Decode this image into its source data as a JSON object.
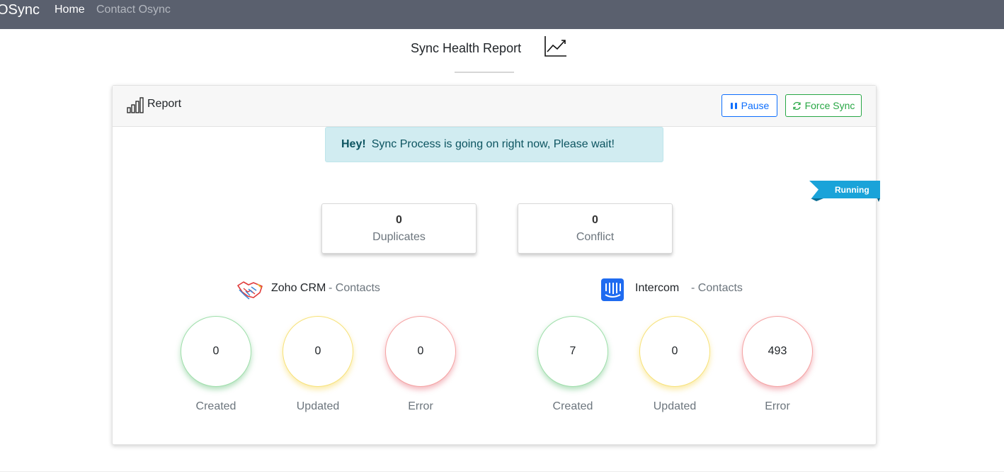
{
  "nav": {
    "brand": "OSync",
    "links": [
      {
        "label": "Home"
      },
      {
        "label": "Contact Osync"
      }
    ]
  },
  "page": {
    "title": "Sync Health Report",
    "title_icon": "trending-up-icon"
  },
  "report": {
    "header_label": "Report",
    "header_icon": "bar-chart-icon",
    "pause_label": "Pause",
    "force_sync_label": "Force Sync",
    "alert_bold": "Hey!",
    "alert_text": "Sync Process is going on right now, Please wait!",
    "status_ribbon": "Running",
    "stats": [
      {
        "value": "0",
        "label": "Duplicates"
      },
      {
        "value": "0",
        "label": "Conflict"
      }
    ],
    "apps": [
      {
        "name": "Zoho CRM",
        "module": "- Contacts",
        "icon": "handshake-icon",
        "counts": [
          {
            "value": "0",
            "label": "Created"
          },
          {
            "value": "0",
            "label": "Updated"
          },
          {
            "value": "0",
            "label": "Error"
          }
        ]
      },
      {
        "name": "Intercom",
        "module": "- Contacts",
        "icon": "intercom-logo-icon",
        "counts": [
          {
            "value": "7",
            "label": "Created"
          },
          {
            "value": "0",
            "label": "Updated"
          },
          {
            "value": "493",
            "label": "Error"
          }
        ]
      }
    ]
  },
  "colors": {
    "navbar": "#5a606e",
    "primary": "#0d6efd",
    "success": "#28a745",
    "alert_bg": "#d1ecf1",
    "ribbon": "#1aa3d9"
  }
}
